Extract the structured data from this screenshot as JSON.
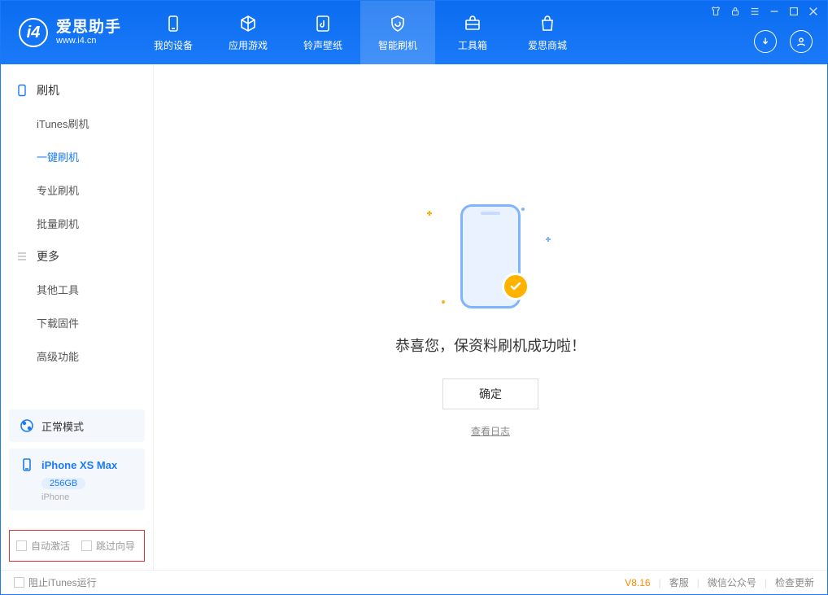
{
  "app": {
    "name_cn": "爱思助手",
    "name_en": "www.i4.cn"
  },
  "tabs": [
    {
      "label": "我的设备"
    },
    {
      "label": "应用游戏"
    },
    {
      "label": "铃声壁纸"
    },
    {
      "label": "智能刷机"
    },
    {
      "label": "工具箱"
    },
    {
      "label": "爱思商城"
    }
  ],
  "sidebar": {
    "group1_title": "刷机",
    "group1_items": [
      "iTunes刷机",
      "一键刷机",
      "专业刷机",
      "批量刷机"
    ],
    "group2_title": "更多",
    "group2_items": [
      "其他工具",
      "下载固件",
      "高级功能"
    ]
  },
  "mode_card": {
    "label": "正常模式"
  },
  "device_card": {
    "name": "iPhone XS Max",
    "storage": "256GB",
    "type": "iPhone"
  },
  "checkboxes": {
    "auto_activate": "自动激活",
    "skip_guide": "跳过向导"
  },
  "main": {
    "success": "恭喜您，保资料刷机成功啦！",
    "confirm": "确定",
    "view_log": "查看日志"
  },
  "footer": {
    "block_itunes": "阻止iTunes运行",
    "version": "V8.16",
    "service": "客服",
    "wechat": "微信公众号",
    "update": "检查更新"
  }
}
